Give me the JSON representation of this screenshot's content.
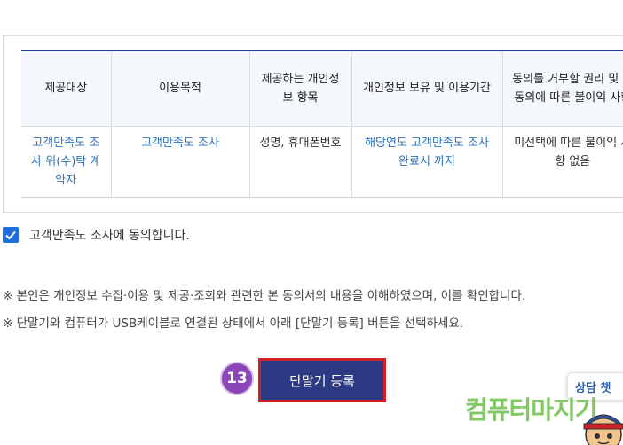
{
  "table": {
    "headers": [
      "제공대상",
      "이용목적",
      "제공하는 개인정보 항목",
      "개인정보 보유 및 이용기간",
      "동의를 거부할 권리 및 미동의에 따른 불이익 사항"
    ],
    "row": [
      "고객만족도 조사 위(수)탁 계약자",
      "고객만족도 조사",
      "성명, 휴대폰번호",
      "해당연도 고객만족도 조사 완료시 까지",
      "미선택에 따른 불이익 사항 없음"
    ]
  },
  "agree": {
    "label": "고객만족도 조사에 동의합니다.",
    "checked": true
  },
  "notes": [
    "※ 본인은 개인정보 수집·이용 및 제공·조회와 관련한 본 동의서의 내용을 이해하였으며, 이를 확인합니다.",
    "※ 단말기와 컴퓨터가 USB케이블로 연결된 상태에서 아래 [단말기 등록] 버튼을 선택하세요."
  ],
  "step_number": "13",
  "register_button": "단말기 등록",
  "chat_tab": "상담  챗",
  "watermark": "컴퓨터마지기",
  "colors": {
    "checkbox": "#1e6fd9",
    "button": "#2b3a82",
    "button_highlight": "#d0202a",
    "step_badge": "#8b45b8",
    "link_text": "#2f73b8",
    "table_top_border": "#2b3f8c"
  },
  "icons": [
    "checkmark-icon",
    "mascot-icon"
  ]
}
